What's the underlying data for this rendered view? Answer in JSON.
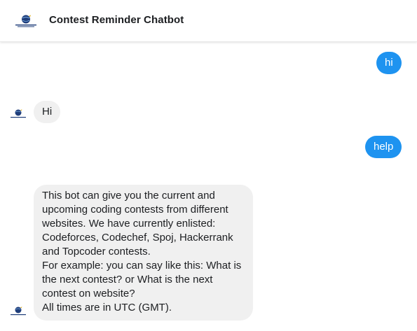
{
  "header": {
    "title": "Contest Reminder Chatbot",
    "logo_icon": "contest-reminder-logo-icon"
  },
  "colors": {
    "user_bubble": "#1e93f0",
    "bot_bubble": "#f0f0f0",
    "logo_globe": "#1f3d7a"
  },
  "messages": [
    {
      "sender": "user",
      "text": "hi"
    },
    {
      "sender": "bot",
      "text": "Hi"
    },
    {
      "sender": "user",
      "text": "help"
    },
    {
      "sender": "bot",
      "paragraphs": [
        "This bot can give you the current and upcoming coding contests from different websites. We have currently enlisted: Codeforces, Codechef, Spoj, Hackerrank and Topcoder contests.",
        "For example: you can say like this: What is the next contest? or What is the next contest on website?",
        "All times are in UTC (GMT)."
      ]
    }
  ]
}
